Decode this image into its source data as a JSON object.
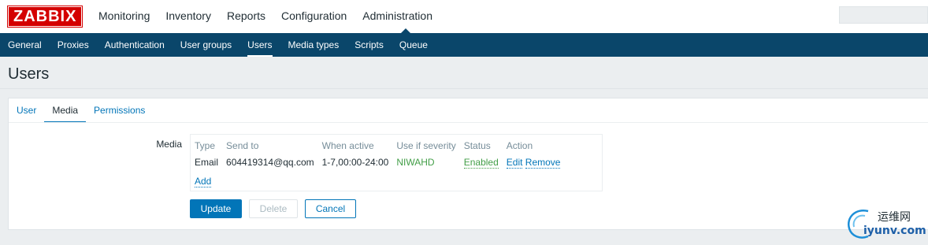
{
  "logo": {
    "text": "ZABBIX"
  },
  "main_menu": [
    "Monitoring",
    "Inventory",
    "Reports",
    "Configuration",
    "Administration"
  ],
  "main_menu_active": "Administration",
  "sub_menu": [
    "General",
    "Proxies",
    "Authentication",
    "User groups",
    "Users",
    "Media types",
    "Scripts",
    "Queue"
  ],
  "sub_menu_active": "Users",
  "page": {
    "title": "Users"
  },
  "tabs": [
    "User",
    "Media",
    "Permissions"
  ],
  "tabs_active": "Media",
  "media": {
    "label": "Media",
    "columns": [
      "Type",
      "Send to",
      "When active",
      "Use if severity",
      "Status",
      "Action"
    ],
    "rows": [
      {
        "type": "Email",
        "send_to": "604419314@qq.com",
        "when_active": "1-7,00:00-24:00",
        "severity": "NIWAHD",
        "status": "Enabled",
        "edit": "Edit",
        "remove": "Remove"
      }
    ],
    "add_label": "Add"
  },
  "buttons": {
    "update": "Update",
    "delete": "Delete",
    "cancel": "Cancel"
  },
  "watermark": {
    "chinese": "运维网",
    "domain": "iyunv.com"
  },
  "colors": {
    "brand_red": "#d40000",
    "nav_blue": "#0a466a",
    "link_blue": "#0275b8",
    "status_green": "#429e47"
  }
}
